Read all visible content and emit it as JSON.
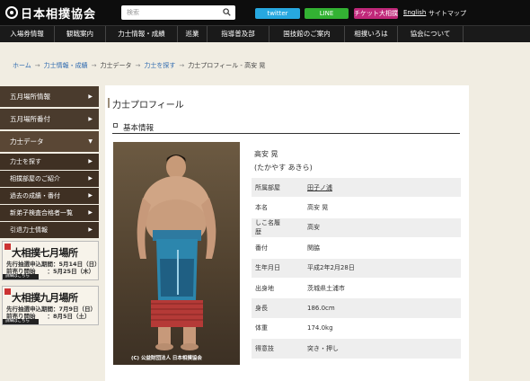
{
  "header": {
    "logo_text": "日本相撲協会",
    "search_placeholder": "検索",
    "twitter": "twitter",
    "line": "LINE",
    "ticket": "チケット大相撲",
    "english": "English",
    "sitemap": "サイトマップ",
    "colors": {
      "twitter": "#27a8e0",
      "line": "#33b233",
      "ticket": "#c0287a"
    }
  },
  "nav": [
    "入場券情報",
    "観戦案内",
    "力士情報・成績",
    "巡業",
    "指導普及部",
    "国技館のご案内",
    "相撲いろは",
    "協会について"
  ],
  "breadcrumb": [
    "ホーム",
    "力士情報・成績",
    "力士データ",
    "力士を探す",
    "力士プロフィール - 高安 晃"
  ],
  "sidebar": {
    "items": [
      "五月場所情報",
      "五月場所番付",
      "力士データ"
    ],
    "sub_items": [
      "力士を探す",
      "相撲部屋のご紹介",
      "過去の成績・番付",
      "新弟子検査合格者一覧",
      "引退力士情報"
    ],
    "banners": [
      {
        "title": "大相撲七月場所",
        "line1": "先行抽選申込期間：5月14日（日）",
        "line2": "前売り開始　　：5月25日（木）",
        "more": "詳細はこちら"
      },
      {
        "title": "大相撲九月場所",
        "line1": "先行抽選申込期間：7月9日（日）",
        "line2": "前売り開始　　：8月5日（土）",
        "more": "詳細はこちら"
      }
    ]
  },
  "main": {
    "title": "力士プロフィール",
    "section": "基本情報",
    "photo_caption": "(C) 公益財団法人 日本相撲協会",
    "name": "高安 晃",
    "reading": "(たかやす あきら)",
    "profile": [
      {
        "label": "所属部屋",
        "value": "田子ノ浦"
      },
      {
        "label": "本名",
        "value": "高安 晃"
      },
      {
        "label": "しこ名履歴",
        "value": "高安"
      },
      {
        "label": "番付",
        "value": "関脇"
      },
      {
        "label": "生年月日",
        "value": "平成2年2月28日"
      },
      {
        "label": "出身地",
        "value": "茨城県土浦市"
      },
      {
        "label": "身長",
        "value": "186.0cm"
      },
      {
        "label": "体重",
        "value": "174.0kg"
      },
      {
        "label": "得意技",
        "value": "突き・押し"
      }
    ]
  }
}
